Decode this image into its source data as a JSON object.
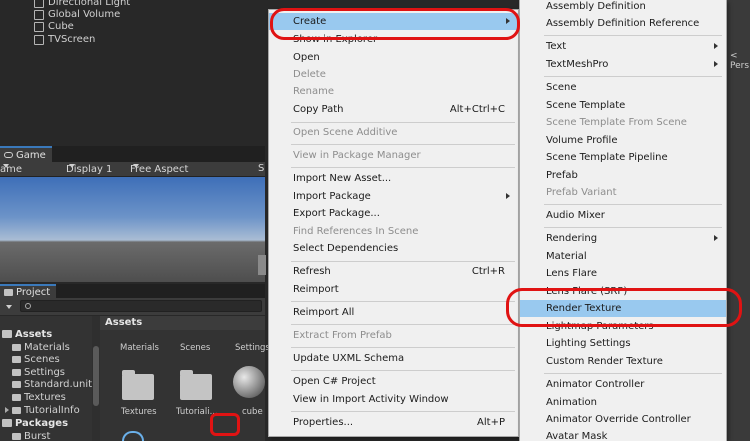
{
  "hierarchy": {
    "items": [
      "Directional Light",
      "Global Volume",
      "Cube",
      "TVScreen"
    ]
  },
  "scene_overlay": {
    "persp_label": "< Pers"
  },
  "game": {
    "tab_label": "Game",
    "toolbar": {
      "mode": "ame",
      "display": "Display 1",
      "aspect": "Free Aspect",
      "scale": "S"
    }
  },
  "project": {
    "tab_label": "Project",
    "tree": {
      "root": "Assets",
      "children": [
        "Materials",
        "Scenes",
        "Settings",
        "Standard.unity",
        "Textures",
        "TutorialInfo"
      ],
      "packages": "Packages",
      "package_children": [
        "Burst"
      ]
    },
    "assets_header": "Assets",
    "asset_columns": [
      "Materials",
      "Scenes",
      "Settings"
    ],
    "asset_items": [
      "Textures",
      "Tutoriali...",
      "cube"
    ]
  },
  "menu1": {
    "items": [
      {
        "label": "Create",
        "submenu": true,
        "highlight": true
      },
      {
        "label": "Show in Explorer"
      },
      {
        "label": "Open"
      },
      {
        "label": "Delete",
        "disabled": true
      },
      {
        "label": "Rename",
        "disabled": true
      },
      {
        "label": "Copy Path",
        "shortcut": "Alt+Ctrl+C"
      },
      {
        "label": "Open Scene Additive",
        "disabled": true
      },
      {
        "label": "View in Package Manager",
        "disabled": true
      },
      {
        "label": "Import New Asset..."
      },
      {
        "label": "Import Package",
        "submenu": true
      },
      {
        "label": "Export Package..."
      },
      {
        "label": "Find References In Scene",
        "disabled": true
      },
      {
        "label": "Select Dependencies"
      },
      {
        "label": "Refresh",
        "shortcut": "Ctrl+R"
      },
      {
        "label": "Reimport"
      },
      {
        "label": "Reimport All"
      },
      {
        "label": "Extract From Prefab",
        "disabled": true
      },
      {
        "label": "Update UXML Schema"
      },
      {
        "label": "Open C# Project"
      },
      {
        "label": "View in Import Activity Window"
      },
      {
        "label": "Properties...",
        "shortcut": "Alt+P"
      }
    ]
  },
  "menu2": {
    "items": [
      {
        "label": "Assembly Definition"
      },
      {
        "label": "Assembly Definition Reference"
      },
      {
        "label": "Text",
        "submenu": true
      },
      {
        "label": "TextMeshPro",
        "submenu": true
      },
      {
        "label": "Scene"
      },
      {
        "label": "Scene Template"
      },
      {
        "label": "Scene Template From Scene",
        "disabled": true
      },
      {
        "label": "Volume Profile"
      },
      {
        "label": "Scene Template Pipeline"
      },
      {
        "label": "Prefab"
      },
      {
        "label": "Prefab Variant",
        "disabled": true
      },
      {
        "label": "Audio Mixer"
      },
      {
        "label": "Rendering",
        "submenu": true
      },
      {
        "label": "Material"
      },
      {
        "label": "Lens Flare"
      },
      {
        "label": "Lens Flare (SRP)"
      },
      {
        "label": "Render Texture",
        "highlight": true
      },
      {
        "label": "Lightmap Parameters"
      },
      {
        "label": "Lighting Settings"
      },
      {
        "label": "Custom Render Texture"
      },
      {
        "label": "Animator Controller"
      },
      {
        "label": "Animation"
      },
      {
        "label": "Animator Override Controller"
      },
      {
        "label": "Avatar Mask"
      }
    ]
  },
  "colors": {
    "menu_bg": "#f0f0f0",
    "highlight": "#99c9ef",
    "annotation": "#e01313",
    "disabled_text": "#8d8d8d"
  }
}
